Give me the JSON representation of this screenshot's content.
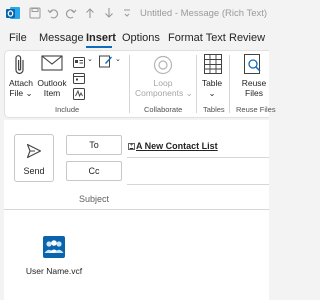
{
  "window": {
    "title": "Untitled - Message (Rich Text)"
  },
  "quick_access": {
    "icons": [
      "outlook-logo-icon",
      "save-icon",
      "undo-icon",
      "redo-icon",
      "arrow-up-icon",
      "arrow-down-icon",
      "customize-icon"
    ]
  },
  "tabs": [
    "File",
    "Message",
    "Insert",
    "Options",
    "Format Text",
    "Review"
  ],
  "active_tab": "Insert",
  "ribbon": {
    "include": {
      "label": "Include",
      "attach_file": [
        "Attach",
        "File"
      ],
      "outlook_item": [
        "Outlook",
        "Item"
      ]
    },
    "collaborate": {
      "label": "Collaborate",
      "loop": [
        "Loop",
        "Components"
      ]
    },
    "tables": {
      "label": "Tables",
      "table": [
        "Table"
      ]
    },
    "reuse": {
      "label": "Reuse Files",
      "reuse": [
        "Reuse",
        "Files"
      ]
    }
  },
  "compose": {
    "send_label": "Send",
    "to_label": "To",
    "cc_label": "Cc",
    "subject_label": "Subject",
    "to_value": "A New Contact List",
    "attachment_name": "User Name.vcf"
  },
  "colors": {
    "accent": "#0f6cbd",
    "outlook_blue": "#0a64ad"
  }
}
